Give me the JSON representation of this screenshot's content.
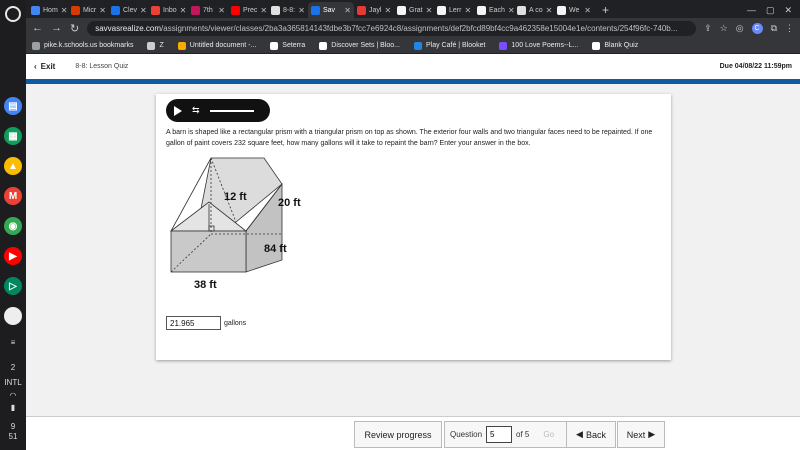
{
  "browser": {
    "tabs": [
      {
        "label": "Hom",
        "color": "#4285f4"
      },
      {
        "label": "Micr",
        "color": "#d83b01"
      },
      {
        "label": "Clev",
        "color": "#1a73e8"
      },
      {
        "label": "Inbo",
        "color": "#ea4335"
      },
      {
        "label": "7th",
        "color": "#c2185b"
      },
      {
        "label": "Prec",
        "color": "#ff0000"
      },
      {
        "label": "8-8:",
        "color": "#e0e0e0"
      },
      {
        "label": "Sav",
        "color": "#1a73e8",
        "active": true
      },
      {
        "label": "Jayl",
        "color": "#e53935"
      },
      {
        "label": "Grat",
        "color": "#f5f5f5"
      },
      {
        "label": "Lerr",
        "color": "#f5f5f5"
      },
      {
        "label": "Each",
        "color": "#f5f5f5"
      },
      {
        "label": "A co",
        "color": "#e0e0e0"
      },
      {
        "label": "We",
        "color": "#f5f5f5"
      }
    ],
    "new_tab": "+",
    "url_host": "savvasrealize.com",
    "url_path": "/assignments/viewer/classes/2ba3a365814143fdbe3b7fcc7e6924c8/assignments/def2bfcd89bf4cc9a462358e15004e1e/contents/254f96fc-740b...",
    "profile_initial": "C",
    "bookmarks": [
      {
        "label": "pike.k.schools.us bookmarks"
      },
      {
        "label": "Z"
      },
      {
        "label": "Untitled document -..."
      },
      {
        "label": "Seterra"
      },
      {
        "label": "Discover Sets | Bloo..."
      },
      {
        "label": "Play Café | Blooket"
      },
      {
        "label": "100 Love Poems--L..."
      },
      {
        "label": "Blank Quiz"
      }
    ]
  },
  "lesson": {
    "exit_label": "Exit",
    "title": "8-8: Lesson Quiz",
    "due": "Due 04/08/22 11:59pm"
  },
  "question": {
    "text": "A barn is shaped like a rectangular prism with a triangular prism on top as shown. The exterior four walls and two triangular faces need to be repainted. If one gallon of paint covers 232 square feet, how many gallons will it take to repaint the barn? Enter your answer in the box.",
    "labels": {
      "height_triangle": "12 ft",
      "height_wall": "20 ft",
      "length": "84 ft",
      "width": "38 ft"
    },
    "answer_value": "21.965",
    "answer_unit": "gallons"
  },
  "nav": {
    "review_label": "Review progress",
    "question_label": "Question",
    "question_number": "5",
    "of_label": "of 5",
    "go_label": "Go",
    "back_label": "Back",
    "next_label": "Next"
  },
  "shelf": {
    "apps": [
      {
        "name": "docs-icon",
        "color": "#4285f4",
        "glyph": "▤"
      },
      {
        "name": "sheets-icon",
        "color": "#0f9d58",
        "glyph": "▦"
      },
      {
        "name": "drive-icon",
        "color": "#fbbc04",
        "glyph": "▲"
      },
      {
        "name": "gmail-icon",
        "color": "#ea4335",
        "glyph": "M"
      },
      {
        "name": "chrome-icon",
        "color": "#34a853",
        "glyph": "◉"
      },
      {
        "name": "youtube-icon",
        "color": "#ff0000",
        "glyph": "▶"
      },
      {
        "name": "play-store-icon",
        "color": "#01875f",
        "glyph": "▷"
      },
      {
        "name": "blank-app-icon",
        "color": "#eeeeee",
        "glyph": ""
      }
    ],
    "badge": "2",
    "ime": "INTL",
    "time_hour": "9",
    "time_min": "51"
  }
}
